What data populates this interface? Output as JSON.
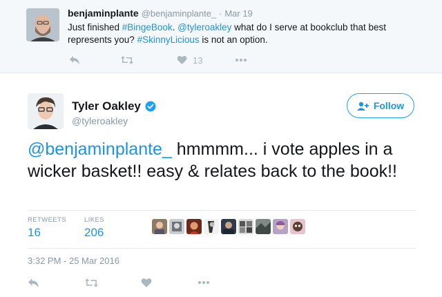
{
  "reply_tweet": {
    "name": "benjaminplante",
    "handle": "@benjaminplante_",
    "separator": "·",
    "date": "Mar 19",
    "text_1": "Just finished ",
    "hashtag_1": "#BingeBook",
    "text_2": ". ",
    "mention": "@tyleroakley",
    "text_3": " what do I serve at bookclub that best represents you? ",
    "hashtag_2": "#SkinnyLicious",
    "text_4": " is not an option.",
    "like_count": "13"
  },
  "main_tweet": {
    "name": "Tyler Oakley",
    "handle": "@tyleroakley",
    "follow_label": "Follow",
    "mention": "@benjaminplante_",
    "text": " hmmmm... i vote apples in a wicker basket!! easy & relates back to the book!!",
    "retweets_label": "RETWEETS",
    "retweets_value": "16",
    "likes_label": "LIKES",
    "likes_value": "206",
    "timestamp": "3:32 PM - 25 Mar 2016"
  },
  "colors": {
    "link": "#1b95e0",
    "muted": "#8899a6",
    "action_icon": "#aab8c2",
    "reply_bg": "#f5f8fa"
  },
  "icons": [
    "reply-icon",
    "retweet-icon",
    "heart-icon",
    "more-icon",
    "verified-badge-icon",
    "follow-person-icon"
  ]
}
